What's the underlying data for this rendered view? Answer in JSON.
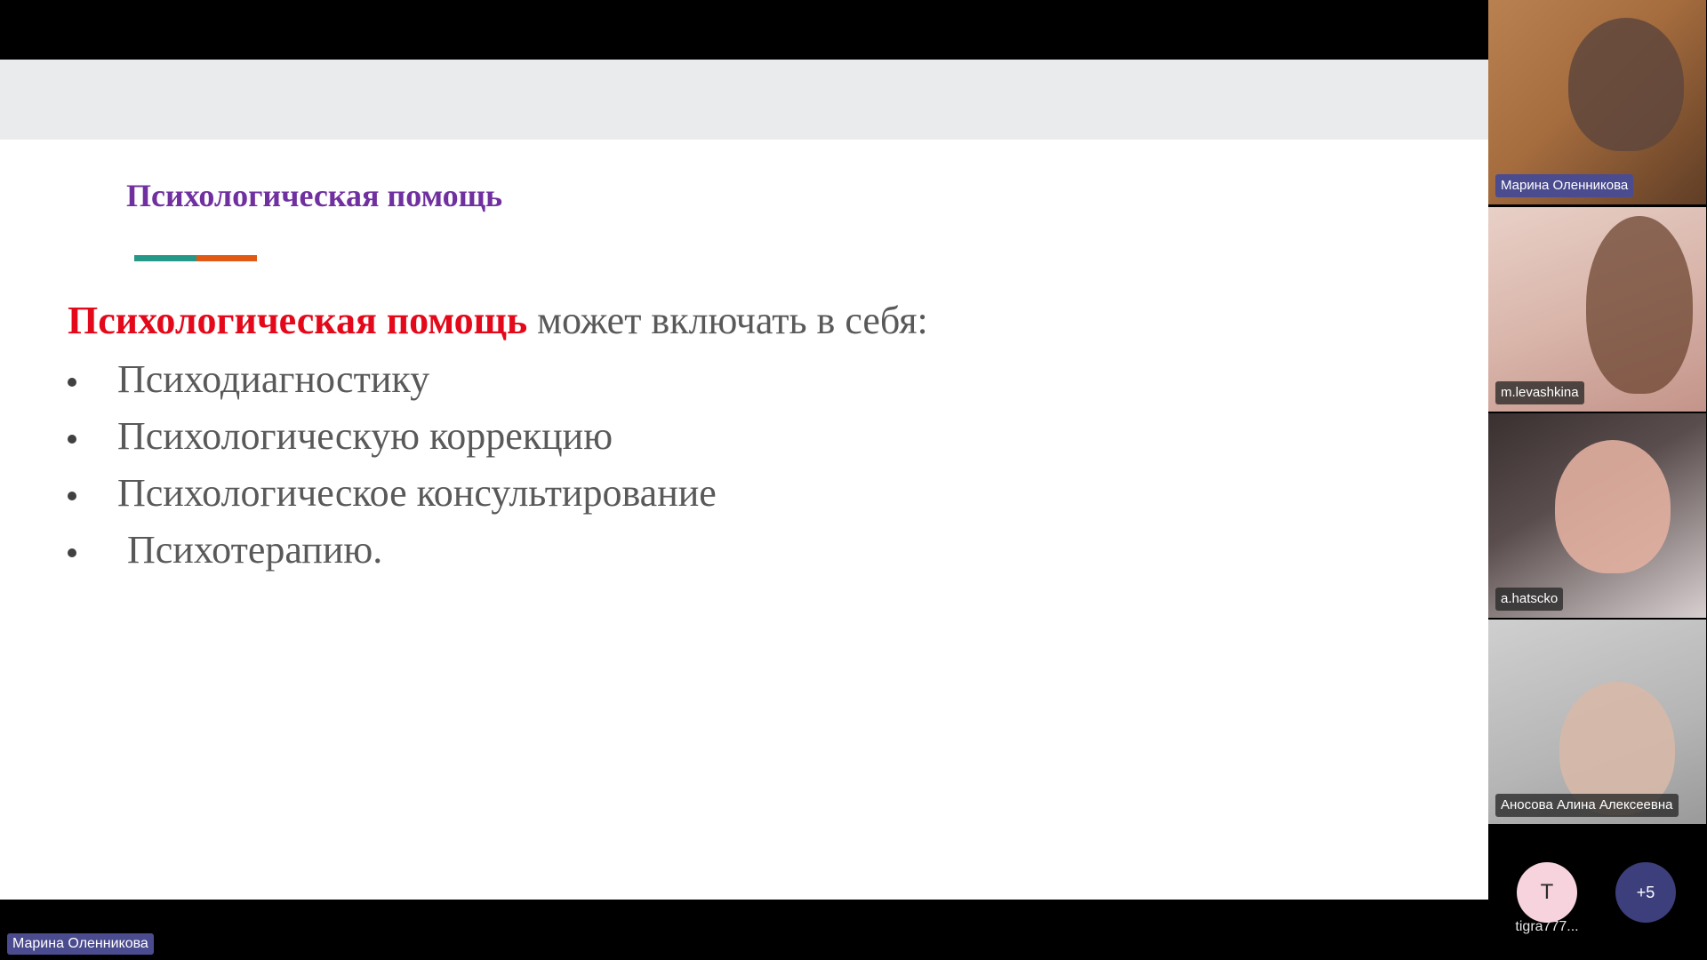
{
  "slide": {
    "title": "Психологическая помощь",
    "intro_highlight": "Психологическая помощь",
    "intro_rest": " может включать в себя:",
    "bullets": [
      "Психодиагностику",
      "Психологическую коррекцию",
      "Психологическое консультирование",
      "Психотерапию."
    ],
    "colors": {
      "title": "#7030a0",
      "highlight": "#e3091b",
      "accent_teal": "#26988a",
      "accent_orange": "#e05a16"
    }
  },
  "presenter": {
    "name": "Марина Оленникова"
  },
  "participants": [
    {
      "name": "Марина Оленникова"
    },
    {
      "name": "m.levashkina"
    },
    {
      "name": "a.hatscko"
    },
    {
      "name": "Аносова Алина Алексеевна"
    }
  ],
  "extra": {
    "avatar_initial": "T",
    "avatar_name": "tigra777...",
    "more_count": "+5"
  }
}
